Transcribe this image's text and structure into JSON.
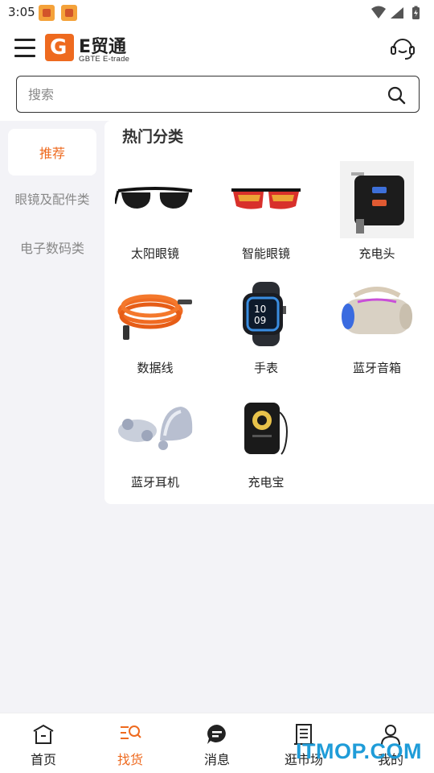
{
  "status_bar": {
    "time": "3:05"
  },
  "header": {
    "logo_title": "E贸通",
    "logo_subtitle": "GBTE E-trade"
  },
  "search": {
    "placeholder": "搜索"
  },
  "sidebar": {
    "items": [
      {
        "label": "推荐",
        "active": true
      },
      {
        "label": "眼镜及配件类",
        "active": false
      },
      {
        "label": "电子数码类",
        "active": false
      }
    ]
  },
  "content": {
    "section_title": "热门分类",
    "categories": [
      {
        "label": "太阳眼镜",
        "icon": "sunglasses-icon"
      },
      {
        "label": "智能眼镜",
        "icon": "smart-glasses-icon"
      },
      {
        "label": "充电头",
        "icon": "charger-icon"
      },
      {
        "label": "数据线",
        "icon": "cable-icon"
      },
      {
        "label": "手表",
        "icon": "watch-icon"
      },
      {
        "label": "蓝牙音箱",
        "icon": "speaker-icon"
      },
      {
        "label": "蓝牙耳机",
        "icon": "earbuds-icon"
      },
      {
        "label": "充电宝",
        "icon": "power-bank-icon"
      }
    ]
  },
  "bottom_nav": {
    "items": [
      {
        "label": "首页",
        "icon": "home-icon"
      },
      {
        "label": "找货",
        "icon": "find-goods-icon",
        "active": true
      },
      {
        "label": "消息",
        "icon": "message-icon"
      },
      {
        "label": "逛市场",
        "icon": "market-icon"
      },
      {
        "label": "我的",
        "icon": "profile-icon"
      }
    ]
  },
  "watermark": "ITMOP.COM",
  "colors": {
    "accent": "#ee6a1f",
    "background": "#f3f3f7"
  }
}
